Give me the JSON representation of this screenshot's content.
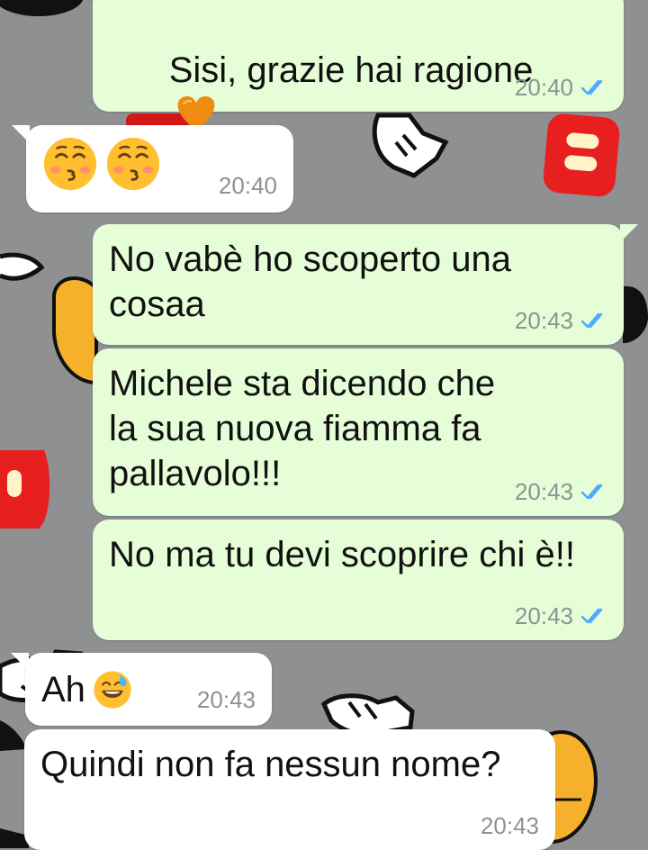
{
  "theme": {
    "wallpaper_color": "#8f9092",
    "outgoing_bubble_color": "#e6fed7",
    "incoming_bubble_color": "#ffffff",
    "read_tick_color": "#4fa9ff",
    "time_color": "#8d9391",
    "text_color": "#111111"
  },
  "icons": {
    "heart": "orange-heart-emoji",
    "kiss": "kissing-face-with-closed-eyes-emoji",
    "sweat": "grinning-face-with-sweat-emoji",
    "ticks": "double-check-icon"
  },
  "messages": [
    {
      "direction": "outgoing",
      "text": "Sisi, grazie hai ragione",
      "time": "20:40",
      "status": "read"
    },
    {
      "direction": "incoming",
      "text": "",
      "time": "20:40",
      "emoji": [
        "kiss",
        "kiss"
      ]
    },
    {
      "direction": "outgoing",
      "text": "No vabè ho scoperto una cosaa",
      "time": "20:43",
      "status": "read"
    },
    {
      "direction": "outgoing",
      "text": "Michele sta dicendo che la sua nuova fiamma fa pallavolo!!!",
      "time": "20:43",
      "status": "read"
    },
    {
      "direction": "outgoing",
      "text": "No ma tu devi scoprire chi è!!",
      "time": "20:43",
      "status": "read"
    },
    {
      "direction": "incoming",
      "text": "Ah",
      "time": "20:43",
      "emoji": [
        "sweat"
      ]
    },
    {
      "direction": "incoming",
      "text": "Quindi non fa nessun nome?",
      "time": "20:43"
    }
  ]
}
